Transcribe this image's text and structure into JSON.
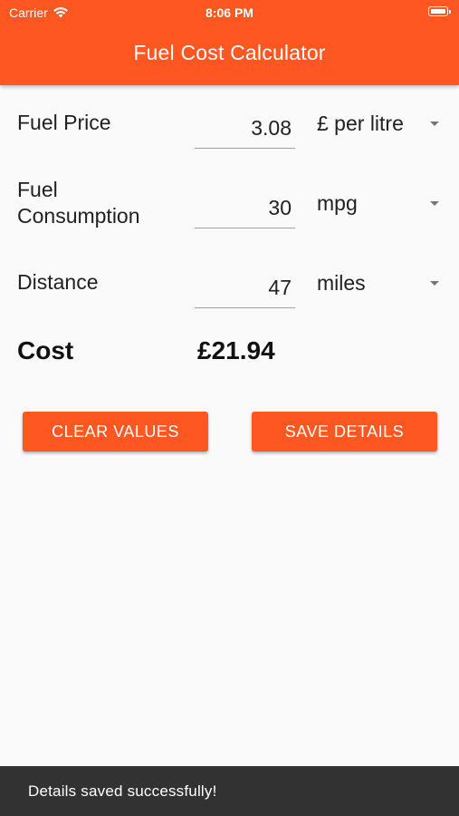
{
  "status_bar": {
    "carrier": "Carrier",
    "time": "8:06 PM"
  },
  "app_bar": {
    "title": "Fuel Cost Calculator",
    "color": "#ff5722"
  },
  "form": {
    "fuel_price": {
      "label": "Fuel Price",
      "value": "3.08",
      "unit": "£ per litre"
    },
    "fuel_consumption": {
      "label_line1": "Fuel",
      "label_line2": "Consumption",
      "value": "30",
      "unit": "mpg"
    },
    "distance": {
      "label": "Distance",
      "value": "47",
      "unit": "miles"
    }
  },
  "result": {
    "label": "Cost",
    "value": "£21.94"
  },
  "buttons": {
    "clear": "CLEAR VALUES",
    "save": "SAVE DETAILS"
  },
  "snackbar": {
    "message": "Details saved successfully!"
  }
}
